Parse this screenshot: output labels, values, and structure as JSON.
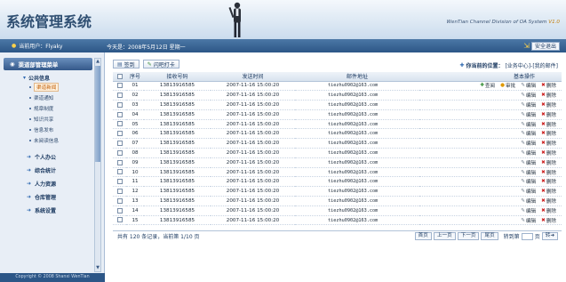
{
  "header": {
    "title": "系统管理系统",
    "company": "WenTian Channel Division of OA System",
    "version": "V1.0"
  },
  "statusbar": {
    "user_label": "当前用户：Flyaky",
    "date_label": "今天是：2008年5月12日 星期一",
    "logout_label": "安全退出"
  },
  "sidebar": {
    "title": "渠道部管理菜单",
    "category": "公共信息",
    "sub_items": [
      {
        "label": "渠道新闻",
        "active": true
      },
      {
        "label": "渠道通知",
        "active": false
      },
      {
        "label": "规章制度",
        "active": false
      },
      {
        "label": "知识共享",
        "active": false
      },
      {
        "label": "信息发布",
        "active": false
      },
      {
        "label": "未阅读信息",
        "active": false
      }
    ],
    "menus": [
      "个人办公",
      "综合统计",
      "人力资源",
      "仓库管理",
      "系统设置"
    ],
    "footer": "Copyright © 2008 Shanxi WenTian"
  },
  "toolbar": {
    "new_label": "签到",
    "print_label": "闪吧打卡"
  },
  "location": {
    "prefix": "你当前的位置：",
    "path": "[业务中心]-[我的邮件]"
  },
  "table": {
    "headers": [
      "序号",
      "接收号码",
      "发送时间",
      "邮件地址",
      "基本操作"
    ],
    "rows": [
      {
        "no": "01",
        "phone": "13813916585",
        "time": "2007-11-16 15:00:20",
        "email": "tiezhu0902@163.com",
        "extra": true
      },
      {
        "no": "02",
        "phone": "13813916585",
        "time": "2007-11-16 15:00:20",
        "email": "tiezhu0902@163.com",
        "extra": false
      },
      {
        "no": "03",
        "phone": "13813916585",
        "time": "2007-11-16 15:00:20",
        "email": "tiezhu0902@163.com",
        "extra": false
      },
      {
        "no": "04",
        "phone": "13813916585",
        "time": "2007-11-16 15:00:20",
        "email": "tiezhu0902@163.com",
        "extra": false
      },
      {
        "no": "05",
        "phone": "13813916585",
        "time": "2007-11-16 15:00:20",
        "email": "tiezhu0902@163.com",
        "extra": false
      },
      {
        "no": "06",
        "phone": "13813916585",
        "time": "2007-11-16 15:00:20",
        "email": "tiezhu0902@163.com",
        "extra": false
      },
      {
        "no": "07",
        "phone": "13813916585",
        "time": "2007-11-16 15:00:20",
        "email": "tiezhu0902@163.com",
        "extra": false
      },
      {
        "no": "08",
        "phone": "13813916585",
        "time": "2007-11-16 15:00:20",
        "email": "tiezhu0902@163.com",
        "extra": false
      },
      {
        "no": "09",
        "phone": "13813916585",
        "time": "2007-11-16 15:00:20",
        "email": "tiezhu0902@163.com",
        "extra": false
      },
      {
        "no": "10",
        "phone": "13813916585",
        "time": "2007-11-16 15:00:20",
        "email": "tiezhu0902@163.com",
        "extra": false
      },
      {
        "no": "11",
        "phone": "13813916585",
        "time": "2007-11-16 15:00:20",
        "email": "tiezhu0902@163.com",
        "extra": false
      },
      {
        "no": "12",
        "phone": "13813916585",
        "time": "2007-11-16 15:00:20",
        "email": "tiezhu0902@163.com",
        "extra": false
      },
      {
        "no": "13",
        "phone": "13813916585",
        "time": "2007-11-16 15:00:20",
        "email": "tiezhu0902@163.com",
        "extra": false
      },
      {
        "no": "14",
        "phone": "13813916585",
        "time": "2007-11-16 15:00:20",
        "email": "tiezhu0902@163.com",
        "extra": false
      },
      {
        "no": "15",
        "phone": "13813916585",
        "time": "2007-11-16 15:00:20",
        "email": "tiezhu0902@163.com",
        "extra": false
      }
    ],
    "ops": {
      "view": "查阅",
      "audit": "审批",
      "edit": "编辑",
      "delete": "删除"
    }
  },
  "pager": {
    "info": "共有 120 条记录，当前第 1/10 页",
    "first": "首页",
    "prev": "上一页",
    "next": "下一页",
    "last": "尾页",
    "goto_label": "转到第",
    "page_unit": "页",
    "go": "转"
  },
  "colors": {
    "accent": "#2c5687",
    "active_item": "#c05a00",
    "delete": "#cc2222"
  }
}
